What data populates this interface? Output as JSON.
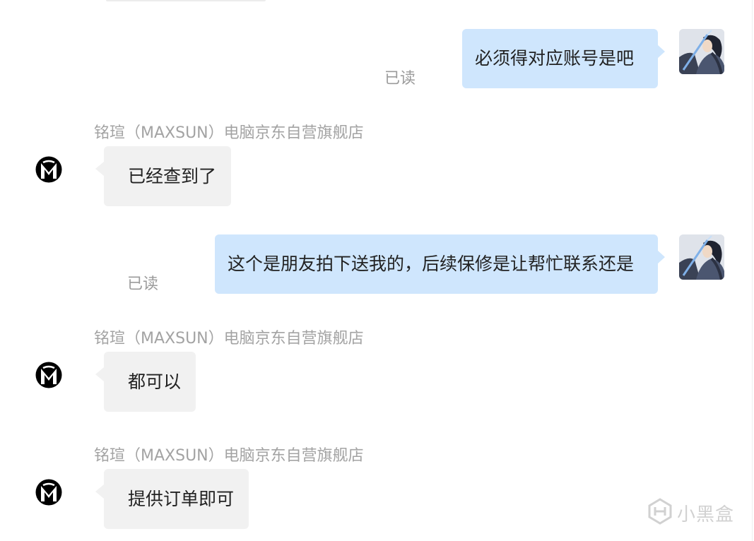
{
  "messages": [
    {
      "direction": "outgoing",
      "text": "必须得对应账号是吧",
      "status": "已读",
      "avatar_icon": "swordsman-avatar-icon"
    },
    {
      "direction": "incoming",
      "sender": "铭瑄（MAXSUN）电脑京东自营旗舰店",
      "text": "已经查到了",
      "avatar_icon": "maxsun-logo-icon"
    },
    {
      "direction": "outgoing",
      "text": "这个是朋友拍下送我的，后续保修是让帮忙联系还是",
      "status": "已读",
      "avatar_icon": "swordsman-avatar-icon"
    },
    {
      "direction": "incoming",
      "sender": "铭瑄（MAXSUN）电脑京东自营旗舰店",
      "text": "都可以",
      "avatar_icon": "maxsun-logo-icon"
    },
    {
      "direction": "incoming",
      "sender": "铭瑄（MAXSUN）电脑京东自营旗舰店",
      "text": "提供订单即可",
      "avatar_icon": "maxsun-logo-icon"
    }
  ],
  "watermark": {
    "text": "小黑盒",
    "icon": "xiaoheihe-logo-icon"
  },
  "colors": {
    "outgoing_bubble": "#cfe6fd",
    "incoming_bubble": "#f1f1f1",
    "meta_text": "#9b9b9b"
  }
}
